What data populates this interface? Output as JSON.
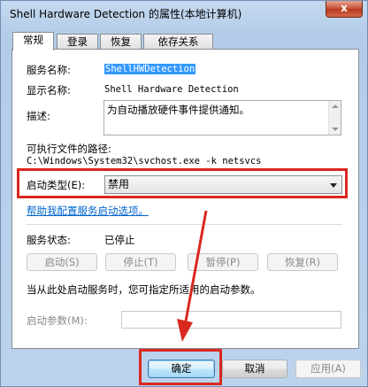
{
  "window": {
    "title": "Shell Hardware Detection 的属性(本地计算机)",
    "close_label": "x"
  },
  "tabs": [
    {
      "label": "常规",
      "active": true
    },
    {
      "label": "登录",
      "active": false
    },
    {
      "label": "恢复",
      "active": false
    },
    {
      "label": "依存关系",
      "active": false
    }
  ],
  "general": {
    "service_name_label": "服务名称:",
    "service_name_value": "ShellHWDetection",
    "display_name_label": "显示名称:",
    "display_name_value": "Shell Hardware Detection",
    "description_label": "描述:",
    "description_value": "为自动播放硬件事件提供通知。",
    "exe_path_label": "可执行文件的路径:",
    "exe_path_value": "C:\\Windows\\System32\\svchost.exe -k netsvcs",
    "startup_type_label": "启动类型(E):",
    "startup_type_value": "禁用",
    "help_link": "帮助我配置服务启动选项。",
    "status_label": "服务状态:",
    "status_value": "已停止",
    "start_button": "启动(S)",
    "stop_button": "停止(T)",
    "pause_button": "暂停(P)",
    "resume_button": "恢复(R)",
    "hint_text": "当从此处启动服务时，您可指定所适用的启动参数。",
    "params_label": "启动参数(M):",
    "params_value": ""
  },
  "footer": {
    "ok_button": "确定",
    "cancel_button": "取消",
    "apply_button": "应用(A)"
  },
  "annotations": {
    "highlight_color": "#d9281f"
  }
}
